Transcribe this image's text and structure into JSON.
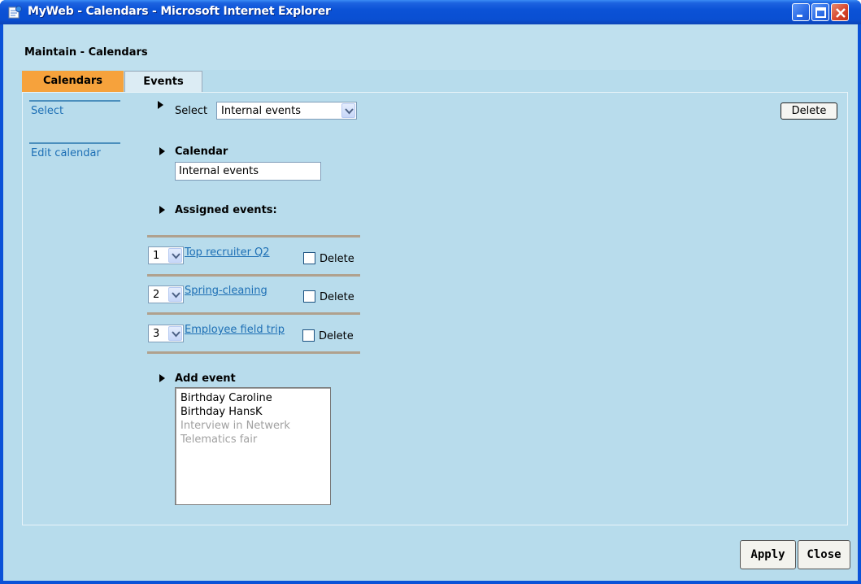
{
  "window": {
    "title": "MyWeb - Calendars - Microsoft Internet Explorer"
  },
  "page": {
    "title": "Maintain - Calendars"
  },
  "tabs": [
    {
      "label": "Calendars",
      "active": true
    },
    {
      "label": "Events",
      "active": false
    }
  ],
  "nav": {
    "items": [
      {
        "label": "Select"
      },
      {
        "label": "Edit calendar"
      }
    ]
  },
  "select_row": {
    "label": "Select",
    "value": "Internal events",
    "delete_label": "Delete"
  },
  "calendar": {
    "heading": "Calendar",
    "name_value": "Internal events"
  },
  "assigned": {
    "heading": "Assigned events:",
    "events": [
      {
        "order": "1",
        "name": "Top recruiter Q2",
        "delete_label": "Delete"
      },
      {
        "order": "2",
        "name": "Spring-cleaning",
        "delete_label": "Delete"
      },
      {
        "order": "3",
        "name": "Employee field trip",
        "delete_label": "Delete"
      }
    ]
  },
  "add_event": {
    "heading": "Add event",
    "options": [
      {
        "label": "Birthday Caroline",
        "enabled": true
      },
      {
        "label": "Birthday HansK",
        "enabled": true
      },
      {
        "label": "Interview in Netwerk",
        "enabled": false
      },
      {
        "label": "Telematics fair",
        "enabled": false
      }
    ]
  },
  "footer": {
    "apply_label": "Apply",
    "close_label": "Close"
  },
  "colors": {
    "title_bar": "#0b52d6",
    "active_tab": "#f6a23c",
    "panel_bg": "#b8dcec",
    "link": "#1d6fb5"
  },
  "icons": {
    "title": "ie-page-icon",
    "minimize": "minimize-icon",
    "maximize": "maximize-icon",
    "close": "close-icon",
    "dropdown": "chevron-down-icon",
    "bullet": "triangle-right-icon"
  }
}
